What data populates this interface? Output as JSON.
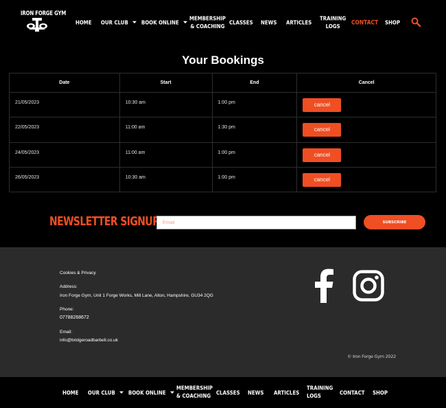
{
  "brand": {
    "logo_text": "IRON FORGE GYM",
    "accent_color": "#f04e23"
  },
  "header_nav": [
    {
      "label": "HOME",
      "dropdown": false
    },
    {
      "label": "OUR CLUB",
      "dropdown": true
    },
    {
      "label": "BOOK ONLINE",
      "dropdown": true
    },
    {
      "label": "MEMBERSHIP & COACHING",
      "line1": "MEMBERSHIP",
      "line2": "& COACHING",
      "dropdown": false
    },
    {
      "label": "CLASSES",
      "dropdown": false
    },
    {
      "label": "NEWS",
      "dropdown": false
    },
    {
      "label": "ARTICLES",
      "dropdown": false
    },
    {
      "label": "TRAINING LOGS",
      "line1": "TRAINING",
      "line2": "LOGS",
      "dropdown": false
    },
    {
      "label": "CONTACT",
      "dropdown": false,
      "active": true
    },
    {
      "label": "SHOP",
      "dropdown": false
    }
  ],
  "search_icon": "search-icon",
  "bookings": {
    "title": "Your Bookings",
    "columns": [
      "Date",
      "Start",
      "End",
      "Cancel"
    ],
    "rows": [
      {
        "date": "21/05/2023",
        "start": "10:30 am",
        "end": "1:00 pm",
        "action": "cancel"
      },
      {
        "date": "22/05/2023",
        "start": "11:00 am",
        "end": "1:30 pm",
        "action": "cancel"
      },
      {
        "date": "24/05/2023",
        "start": "11:00 am",
        "end": "1:00 pm",
        "action": "cancel"
      },
      {
        "date": "26/05/2023",
        "start": "10:30 am",
        "end": "1:00 pm",
        "action": "cancel"
      }
    ]
  },
  "newsletter": {
    "title": "NEWSLETTER SIGNUP",
    "email_placeholder": "Email",
    "email_value": "",
    "subscribe_label": "SUBSCRIBE"
  },
  "footer": {
    "cookies_link": "Cookies & Privacy",
    "address_label": "Address:",
    "address_value": "Iron Forge Gym, Unit 1 Forge Works, Mill Lane, Alton, Hampshire, GU34 2QG",
    "phone_label": "Phone:",
    "phone_value": "07788268672",
    "email_label": "Email:",
    "email_value": "info@bridgeroadbarbell.co.uk",
    "social": [
      "facebook-icon",
      "instagram-icon"
    ],
    "copyright": "© Iron Forge Gym 2022"
  },
  "footer_nav": [
    {
      "label": "HOME",
      "dropdown": false
    },
    {
      "label": "OUR CLUB",
      "dropdown": true
    },
    {
      "label": "BOOK ONLINE",
      "dropdown": true
    },
    {
      "label": "MEMBERSHIP & COACHING",
      "line1": "MEMBERSHIP",
      "line2": "& COACHING",
      "dropdown": false
    },
    {
      "label": "CLASSES",
      "dropdown": false
    },
    {
      "label": "NEWS",
      "dropdown": false
    },
    {
      "label": "ARTICLES",
      "dropdown": false
    },
    {
      "label": "TRAINING LOGS",
      "line1": "TRAINING",
      "line2": "LOGS",
      "dropdown": false
    },
    {
      "label": "CONTACT",
      "dropdown": false
    },
    {
      "label": "SHOP",
      "dropdown": false
    }
  ]
}
